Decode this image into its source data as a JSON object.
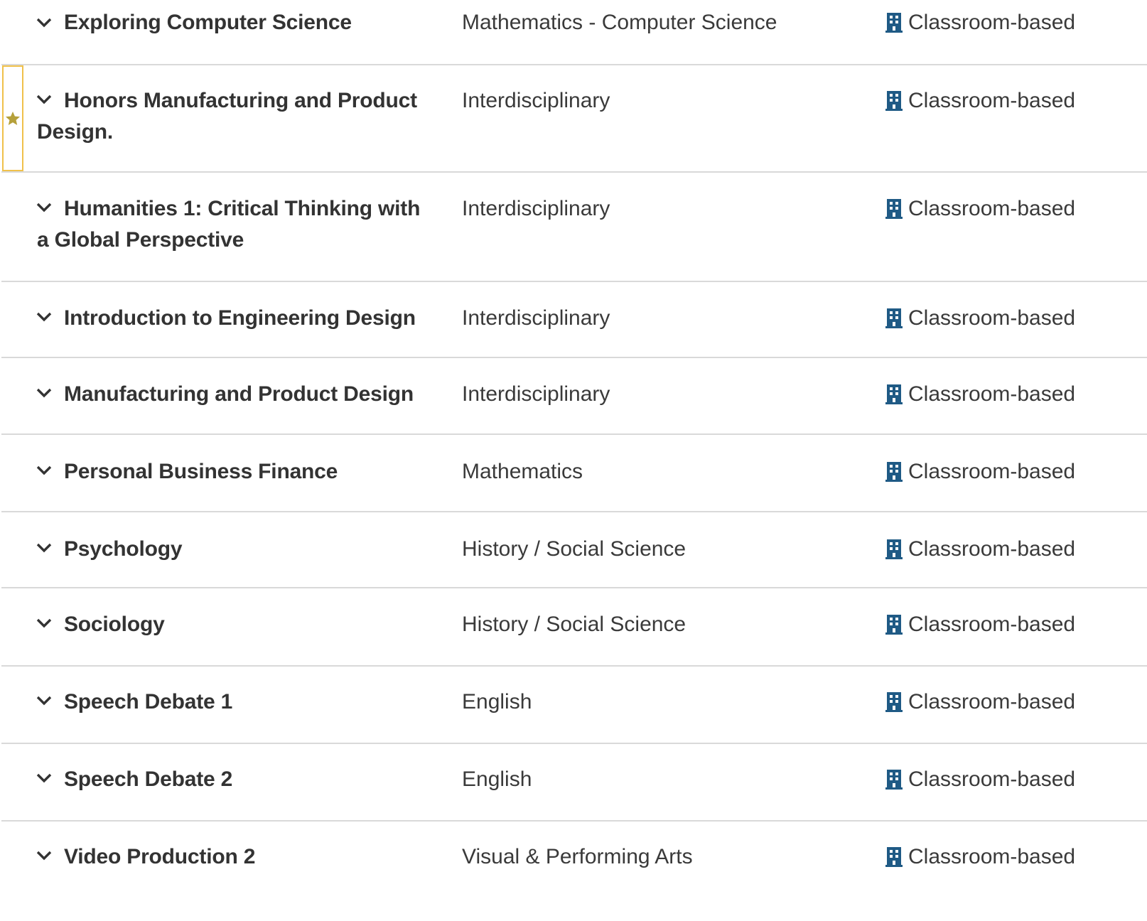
{
  "colors": {
    "text": "#333333",
    "divider": "#d9d9d9",
    "favorite_border": "#f0c14b",
    "favorite_star": "#b5a03a",
    "building_icon": "#1f5a85"
  },
  "courses": [
    {
      "title": "Exploring Computer Science",
      "subject": "Mathematics - Computer Science",
      "format": "Classroom-based",
      "favorite": false,
      "icon": "chevron-down-icon",
      "format_icon": "building-icon"
    },
    {
      "title": "Honors Manufacturing and Product Design.",
      "subject": "Interdisciplinary",
      "format": "Classroom-based",
      "favorite": true,
      "icon": "chevron-down-icon",
      "format_icon": "building-icon"
    },
    {
      "title": "Humanities 1: Critical Thinking with a Global Perspective",
      "subject": "Interdisciplinary",
      "format": "Classroom-based",
      "favorite": false,
      "icon": "chevron-down-icon",
      "format_icon": "building-icon"
    },
    {
      "title": "Introduction to Engineering Design",
      "subject": "Interdisciplinary",
      "format": "Classroom-based",
      "favorite": false,
      "icon": "chevron-down-icon",
      "format_icon": "building-icon"
    },
    {
      "title": "Manufacturing and Product Design",
      "subject": "Interdisciplinary",
      "format": "Classroom-based",
      "favorite": false,
      "icon": "chevron-down-icon",
      "format_icon": "building-icon"
    },
    {
      "title": "Personal Business Finance",
      "subject": "Mathematics",
      "format": "Classroom-based",
      "favorite": false,
      "icon": "chevron-down-icon",
      "format_icon": "building-icon"
    },
    {
      "title": "Psychology",
      "subject": "History / Social Science",
      "format": "Classroom-based",
      "favorite": false,
      "icon": "chevron-down-icon",
      "format_icon": "building-icon"
    },
    {
      "title": "Sociology",
      "subject": "History / Social Science",
      "format": "Classroom-based",
      "favorite": false,
      "icon": "chevron-down-icon",
      "format_icon": "building-icon"
    },
    {
      "title": "Speech Debate 1",
      "subject": "English",
      "format": "Classroom-based",
      "favorite": false,
      "icon": "chevron-down-icon",
      "format_icon": "building-icon"
    },
    {
      "title": "Speech Debate 2",
      "subject": "English",
      "format": "Classroom-based",
      "favorite": false,
      "icon": "chevron-down-icon",
      "format_icon": "building-icon"
    },
    {
      "title": "Video Production 2",
      "subject": "Visual & Performing Arts",
      "format": "Classroom-based",
      "favorite": false,
      "icon": "chevron-down-icon",
      "format_icon": "building-icon"
    }
  ]
}
